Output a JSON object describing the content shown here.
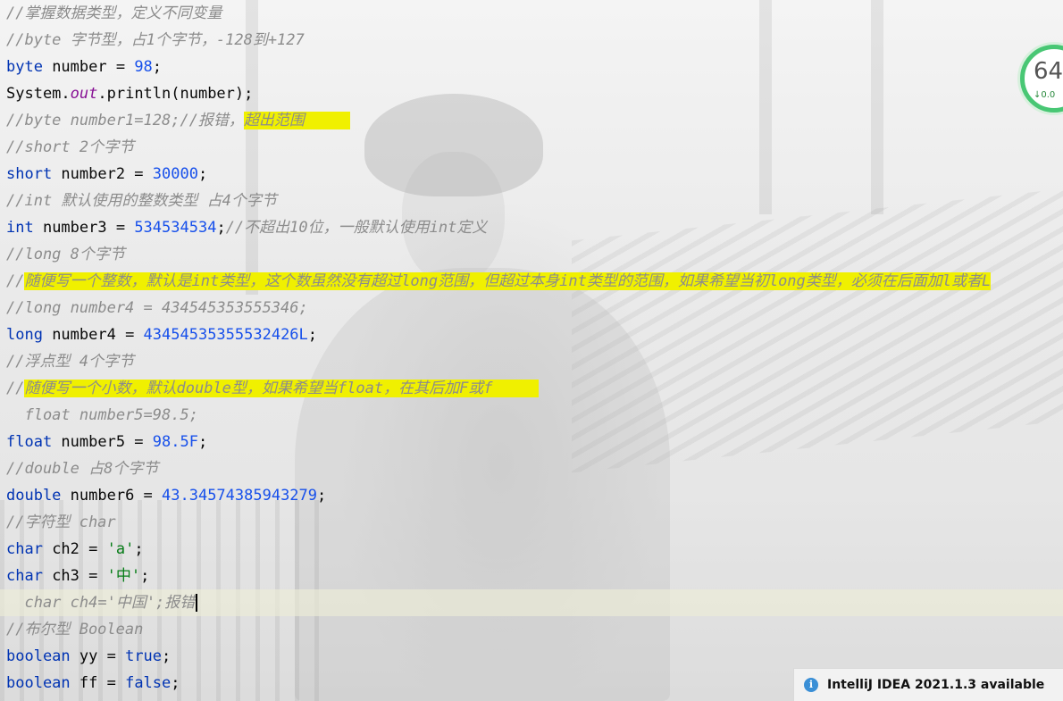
{
  "meter": {
    "value": "64",
    "sub": "↓0.0"
  },
  "notification": {
    "icon": "info-icon",
    "text": "IntelliJ IDEA 2021.1.3 available"
  },
  "code": {
    "l1": "//掌握数据类型，定义不同变量",
    "l2": "//byte 字节型，占1个字节，-128到+127",
    "l3": {
      "kw": "byte",
      "id": " number = ",
      "num": "98",
      "end": ";"
    },
    "l4": {
      "a": "System.",
      "fld": "out",
      "b": ".println(number);"
    },
    "l5": {
      "pre": "//byte number1=128;//报错，",
      "hl": "超出范围     "
    },
    "l6": "//short 2个字节",
    "l7": {
      "kw": "short",
      "id": " number2 = ",
      "num": "30000",
      "end": ";"
    },
    "l8": "//int 默认使用的整数类型 占4个字节",
    "l9": {
      "kw": "int",
      "id": " number3 = ",
      "num": "534534534",
      "end": ";",
      "cm": "//不超出10位，一般默认使用int定义"
    },
    "l10": "//long 8个字节",
    "l11": {
      "pre": "//",
      "hl": "随便写一个整数，默认是int类型，这个数虽然没有超过long范围，但超过本身int类型的范围，如果希望当初long类型，必须在后面加l或者L"
    },
    "l12": "//long number4 = 434545353555346;",
    "l13": {
      "kw": "long",
      "id": " number4 = ",
      "num": "43454535355532426L",
      "end": ";"
    },
    "l14": "//浮点型 4个字节",
    "l15": {
      "pre": "//",
      "hl": "随便写一个小数，默认double型，如果希望当float，在其后加F或f     "
    },
    "l16": "  float number5=98.5;",
    "l17": {
      "kw": "float",
      "id": " number5 = ",
      "num": "98.5F",
      "end": ";"
    },
    "l18": "//double 占8个字节",
    "l19": {
      "kw": "double",
      "id": " number6 = ",
      "num": "43.34574385943279",
      "end": ";"
    },
    "l20": "//字符型 char",
    "l21": {
      "kw": "char",
      "id": " ch2 = ",
      "str": "'a'",
      "end": ";"
    },
    "l22": {
      "kw": "char",
      "id": " ch3 = ",
      "str": "'中'",
      "end": ";"
    },
    "l23": "  char ch4='中国';报错",
    "l24": "//布尔型 Boolean",
    "l25": {
      "kw": "boolean",
      "id": " yy = ",
      "kw2": "true",
      "end": ";"
    },
    "l26": {
      "kw": "boolean",
      "id": " ff = ",
      "kw2": "false",
      "end": ";"
    }
  }
}
